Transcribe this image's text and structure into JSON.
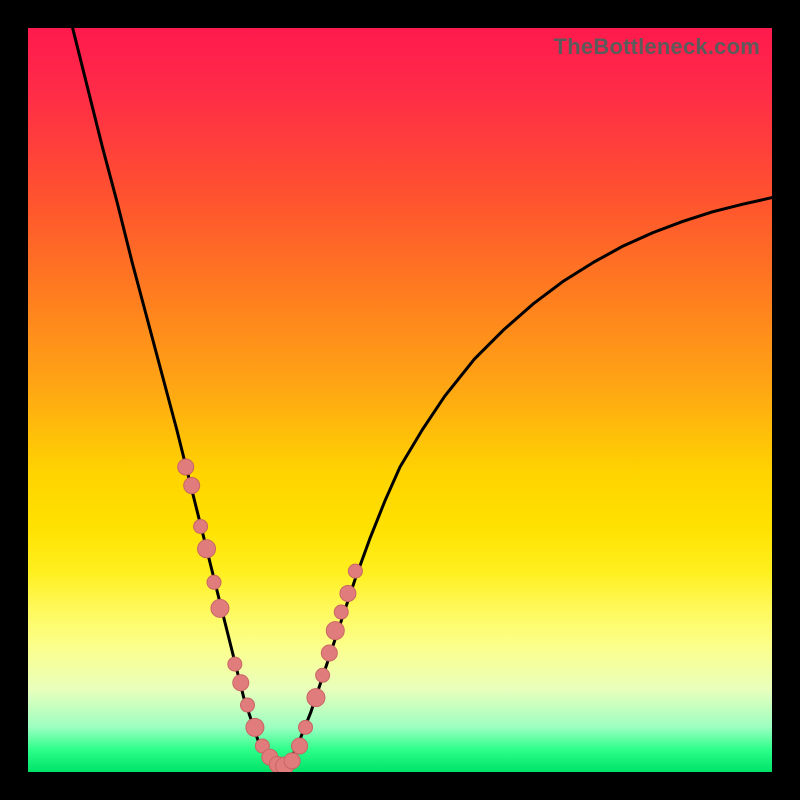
{
  "watermark": "TheBottleneck.com",
  "colors": {
    "frame": "#000000",
    "curve": "#000000",
    "marker_fill": "#e17c7c",
    "marker_stroke": "#c96565"
  },
  "chart_data": {
    "type": "line",
    "title": "",
    "xlabel": "",
    "ylabel": "",
    "xlim": [
      0,
      100
    ],
    "ylim": [
      0,
      100
    ],
    "curve": {
      "x": [
        6,
        8,
        10,
        12,
        14,
        16,
        18,
        20,
        22,
        23.5,
        25,
        26.5,
        28,
        29,
        30,
        31,
        32,
        33,
        34,
        35,
        36,
        38,
        40,
        42,
        44,
        46,
        48,
        50,
        53,
        56,
        60,
        64,
        68,
        72,
        76,
        80,
        84,
        88,
        92,
        96,
        100
      ],
      "y": [
        100,
        92,
        84,
        76.5,
        68.5,
        61,
        53.5,
        46,
        38,
        32,
        26,
        20,
        14,
        10,
        7,
        4,
        2,
        1,
        0.7,
        1.5,
        3,
        8,
        14,
        20,
        26,
        31.5,
        36.5,
        41,
        46,
        50.5,
        55.5,
        59.5,
        63,
        66,
        68.5,
        70.7,
        72.5,
        74,
        75.3,
        76.3,
        77.2
      ]
    },
    "markers": {
      "x": [
        21.2,
        22.0,
        23.2,
        24.0,
        25.0,
        25.8,
        27.8,
        28.6,
        29.5,
        30.5,
        31.5,
        32.5,
        33.5,
        34.5,
        35.5,
        36.5,
        37.3,
        38.7,
        39.6,
        40.5,
        41.3,
        42.1,
        43.0,
        44.0
      ],
      "y": [
        41,
        38.5,
        33,
        30,
        25.5,
        22,
        14.5,
        12,
        9,
        6,
        3.5,
        2,
        1,
        0.8,
        1.5,
        3.5,
        6,
        10,
        13,
        16,
        19,
        21.5,
        24,
        27
      ],
      "r": [
        8,
        8,
        7,
        9,
        7,
        9,
        7,
        8,
        7,
        9,
        7,
        8,
        8,
        9,
        8,
        8,
        7,
        9,
        7,
        8,
        9,
        7,
        8,
        7
      ]
    }
  }
}
